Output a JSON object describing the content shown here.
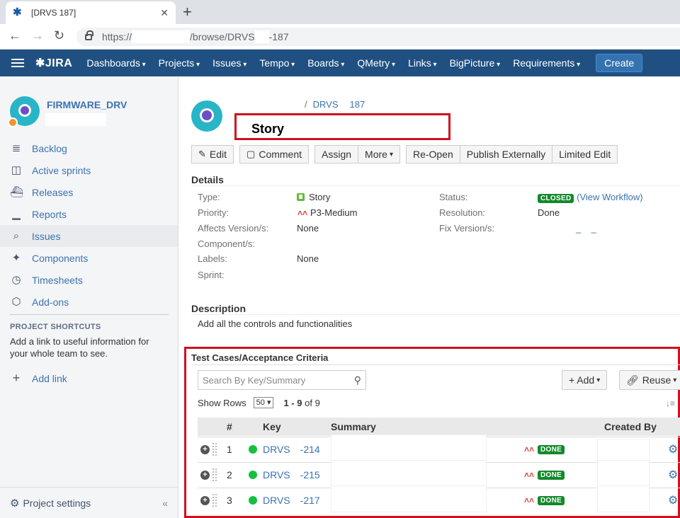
{
  "browser": {
    "tab_title": "[DRVS    187]",
    "url_scheme": "https://",
    "url_path": "/browse/DRVS",
    "url_tail": "-187"
  },
  "header": {
    "logo": "JIRA",
    "menu": [
      "Dashboards",
      "Projects",
      "Issues",
      "Tempo",
      "Boards",
      "QMetry",
      "Links",
      "BigPicture",
      "Requirements"
    ],
    "create_label": "Create"
  },
  "sidebar": {
    "project_name": "FIRMWARE_DRV",
    "items": [
      {
        "label": "Backlog",
        "icon": "backlog-icon",
        "glyph": "≣"
      },
      {
        "label": "Active sprints",
        "icon": "board-icon",
        "glyph": "◫"
      },
      {
        "label": "Releases",
        "icon": "ship-icon",
        "glyph": "⛴"
      },
      {
        "label": "Reports",
        "icon": "chart-icon",
        "glyph": "▁"
      },
      {
        "label": "Issues",
        "icon": "issues-search-icon",
        "glyph": "⌕"
      },
      {
        "label": "Components",
        "icon": "puzzle-icon",
        "glyph": "✦"
      },
      {
        "label": "Timesheets",
        "icon": "clock-icon",
        "glyph": "◷"
      },
      {
        "label": "Add-ons",
        "icon": "addon-icon",
        "glyph": "⬡"
      }
    ],
    "shortcuts_heading": "PROJECT SHORTCUTS",
    "shortcuts_text": "Add a link to useful information for your whole team to see.",
    "add_link": "Add link",
    "settings": "Project settings",
    "collapse": "«"
  },
  "issue": {
    "breadcrumb_project": "DRVS",
    "breadcrumb_key": "187",
    "summary": "Story",
    "toolbar": {
      "edit": "Edit",
      "comment": "Comment",
      "assign": "Assign",
      "more": "More",
      "reopen": "Re-Open",
      "publish": "Publish Externally",
      "limited": "Limited Edit"
    },
    "details_heading": "Details",
    "fields": {
      "type_label": "Type:",
      "type_value": "Story",
      "priority_label": "Priority:",
      "priority_value": "P3-Medium",
      "affects_label": "Affects Version/s:",
      "affects_value": "None",
      "component_label": "Component/s:",
      "labels_label": "Labels:",
      "labels_value": "None",
      "sprint_label": "Sprint:",
      "status_label": "Status:",
      "status_value": "CLOSED",
      "view_workflow": "(View Workflow)",
      "resolution_label": "Resolution:",
      "resolution_value": "Done",
      "fix_label": "Fix Version/s:"
    },
    "description_heading": "Description",
    "description": "Add all the controls and functionalities"
  },
  "testcases": {
    "title": "Test Cases/Acceptance Criteria",
    "search_placeholder": "Search By Key/Summary",
    "add_label": "+ Add",
    "reuse_label": "Reuse",
    "show_rows_label": "Show Rows",
    "rows_value": "50",
    "paging_range": "1 - 9",
    "paging_total": "of 9",
    "columns": [
      "#",
      "Key",
      "Summary",
      "Created By"
    ],
    "rows": [
      {
        "num": "1",
        "key_prefix": "DRVS",
        "key_suffix": "-214",
        "status": "DONE"
      },
      {
        "num": "2",
        "key_prefix": "DRVS",
        "key_suffix": "-215",
        "status": "DONE"
      },
      {
        "num": "3",
        "key_prefix": "DRVS",
        "key_suffix": "-217",
        "status": "DONE"
      }
    ]
  }
}
